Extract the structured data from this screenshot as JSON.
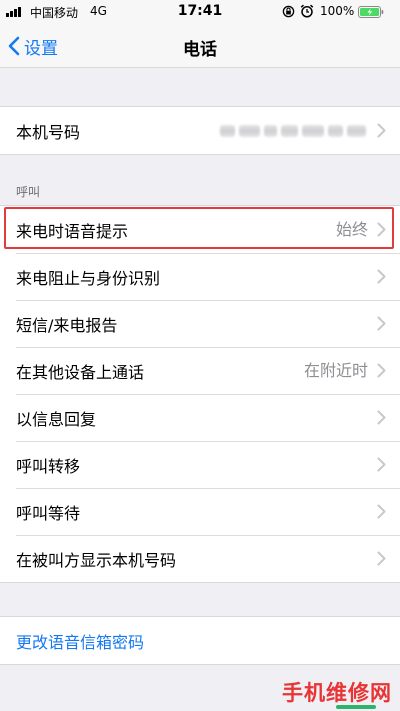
{
  "status_bar": {
    "carrier": "中国移动",
    "network": "4G",
    "time": "17:41",
    "battery": "100%",
    "icons": [
      "signal-icon",
      "lock-rotation-icon",
      "alarm-icon",
      "battery-icon"
    ]
  },
  "nav": {
    "back_label": "设置",
    "title": "电话"
  },
  "groups": {
    "my_number": {
      "label": "本机号码"
    },
    "calls_header": "呼叫",
    "calls": [
      {
        "label": "来电时语音提示",
        "value": "始终"
      },
      {
        "label": "来电阻止与身份识别",
        "value": ""
      },
      {
        "label": "短信/来电报告",
        "value": ""
      },
      {
        "label": "在其他设备上通话",
        "value": "在附近时"
      },
      {
        "label": "以信息回复",
        "value": ""
      },
      {
        "label": "呼叫转移",
        "value": ""
      },
      {
        "label": "呼叫等待",
        "value": ""
      },
      {
        "label": "在被叫方显示本机号码",
        "value": ""
      }
    ],
    "voicemail": {
      "label": "更改语音信箱密码"
    }
  },
  "watermark": "手机维修网",
  "colors": {
    "accent": "#1478f2",
    "highlight": "#e03c3c",
    "background": "#efeff4",
    "secondary_text": "#8e8e93"
  }
}
